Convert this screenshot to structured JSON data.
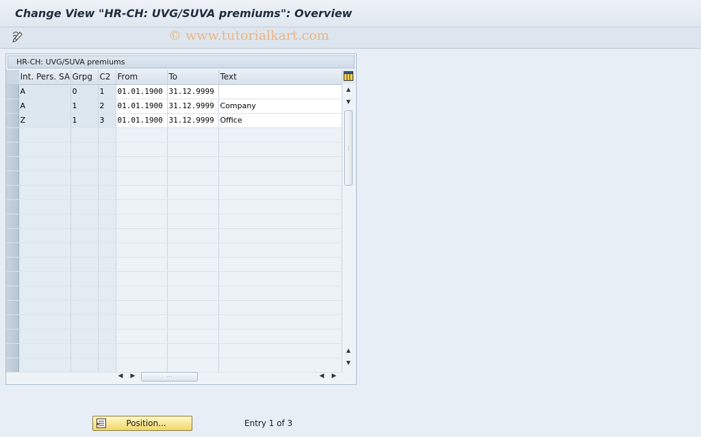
{
  "window": {
    "title": "Change View \"HR-CH: UVG/SUVA premiums\": Overview"
  },
  "toolbar": {
    "buttons": [
      {
        "icon": "display-change-icon"
      }
    ]
  },
  "watermark": "© www.tutorialkart.com",
  "panel": {
    "title": "HR-CH: UVG/SUVA premiums"
  },
  "table": {
    "columns": [
      "Int. Pers. SA",
      "Grpg",
      "C2",
      "From",
      "To",
      "Text"
    ],
    "rows": [
      {
        "sa": "A",
        "grpg": "0",
        "c2": "1",
        "from": "01.01.1900",
        "to": "31.12.9999",
        "text": ""
      },
      {
        "sa": "A",
        "grpg": "1",
        "c2": "2",
        "from": "01.01.1900",
        "to": "31.12.9999",
        "text": "Company"
      },
      {
        "sa": "Z",
        "grpg": "1",
        "c2": "3",
        "from": "01.01.1900",
        "to": "31.12.9999",
        "text": "Office"
      }
    ]
  },
  "footer": {
    "position_button": "Position...",
    "entry_text": "Entry 1 of 3"
  },
  "colors": {
    "background": "#e8eef5",
    "button_yellow": "#f3d86a",
    "watermark": "#eeac6e"
  }
}
